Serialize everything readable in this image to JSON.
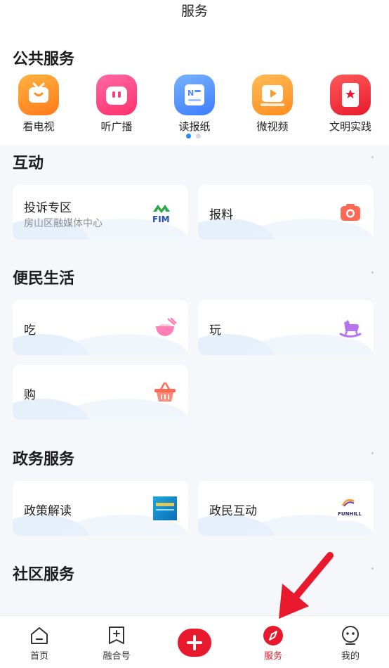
{
  "header": {
    "title": "服务"
  },
  "public_services": {
    "title": "公共服务",
    "items": [
      {
        "label": "看电视",
        "icon": "tv-icon",
        "color": "#ff8a1f"
      },
      {
        "label": "听广播",
        "icon": "radio-icon",
        "color": "#ff3d7f"
      },
      {
        "label": "读报纸",
        "icon": "newspaper-icon",
        "color": "#4d8dff"
      },
      {
        "label": "微视频",
        "icon": "video-icon",
        "color": "#ff9a2e"
      },
      {
        "label": "文明实践",
        "icon": "civilization-icon",
        "color": "#f0303a"
      }
    ],
    "carousel": {
      "active_dot_color": "#1f8fff",
      "inactive_dot_color": "#d3d7de"
    }
  },
  "interaction": {
    "title": "互动",
    "cards": [
      {
        "title": "投诉专区",
        "subtitle": "房山区融媒体中心",
        "icon": "fm-logo-icon"
      },
      {
        "title": "报料",
        "icon": "camera-icon"
      }
    ]
  },
  "life": {
    "title": "便民生活",
    "cards": [
      {
        "title": "吃",
        "icon": "noodle-bowl-icon"
      },
      {
        "title": "玩",
        "icon": "rocking-horse-icon"
      },
      {
        "title": "购",
        "icon": "shopping-basket-icon"
      }
    ]
  },
  "government": {
    "title": "政务服务",
    "cards": [
      {
        "title": "政策解读",
        "icon": "policy-thumbnail-icon"
      },
      {
        "title": "政民互动",
        "icon": "funhill-logo-icon",
        "logo_text": "FUNHILL"
      }
    ]
  },
  "community": {
    "title": "社区服务"
  },
  "tabbar": {
    "items": [
      {
        "label": "首页",
        "icon": "home-icon",
        "active": false
      },
      {
        "label": "融合号",
        "icon": "fusion-icon",
        "active": false
      },
      {
        "label": "",
        "icon": "plus-icon",
        "active": false
      },
      {
        "label": "服务",
        "icon": "compass-icon",
        "active": true
      },
      {
        "label": "我的",
        "icon": "profile-icon",
        "active": false
      }
    ],
    "active_color": "#e8192c"
  }
}
